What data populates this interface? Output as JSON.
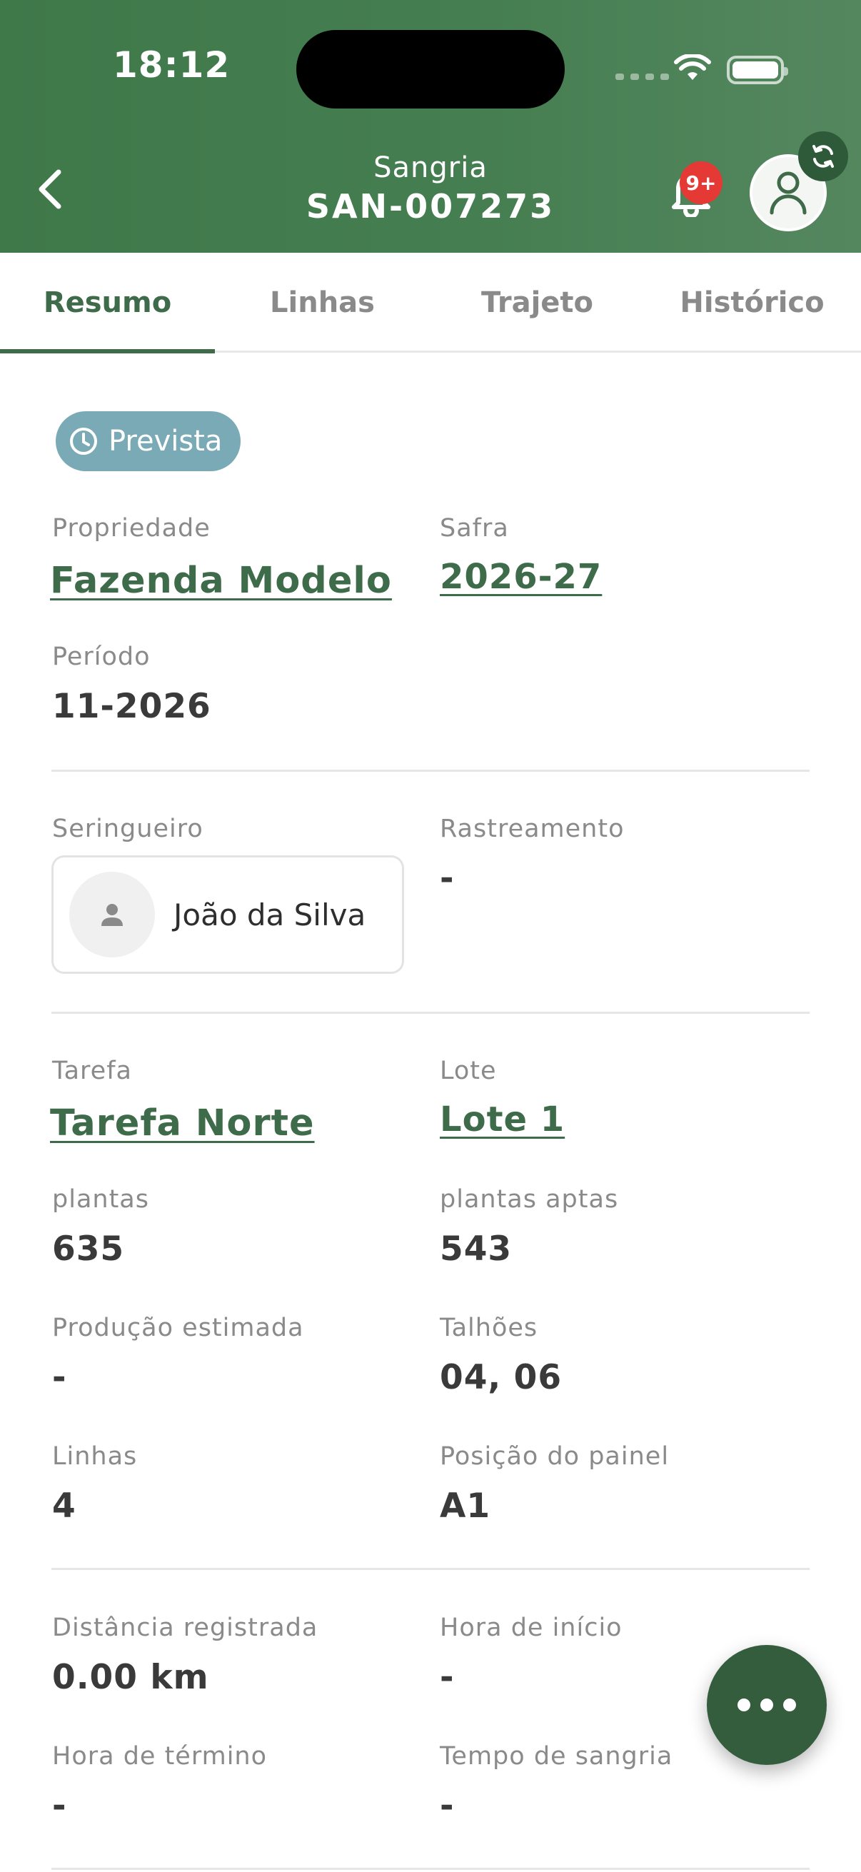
{
  "status_bar": {
    "time": "18:12"
  },
  "header": {
    "subtitle": "Sangria",
    "title": "SAN-007273",
    "notification_badge": "9+",
    "colors": {
      "primary": "#3f7849",
      "badge": "#e53935"
    }
  },
  "tabs": [
    {
      "label": "Resumo",
      "active": true
    },
    {
      "label": "Linhas",
      "active": false
    },
    {
      "label": "Trajeto",
      "active": false
    },
    {
      "label": "Histórico",
      "active": false
    }
  ],
  "status_chip": {
    "label": "Prevista",
    "icon": "clock-icon",
    "color": "#79aab6"
  },
  "summary": {
    "propriedade": {
      "label": "Propriedade",
      "value": "Fazenda Modelo"
    },
    "safra": {
      "label": "Safra",
      "value": "2026-27"
    },
    "periodo": {
      "label": "Período",
      "value": "11-2026"
    }
  },
  "assignment": {
    "seringueiro": {
      "label": "Seringueiro",
      "value": "João da Silva"
    },
    "rastreamento": {
      "label": "Rastreamento",
      "value": "-"
    }
  },
  "task": {
    "tarefa": {
      "label": "Tarefa",
      "value": "Tarefa Norte"
    },
    "lote": {
      "label": "Lote",
      "value": "Lote 1"
    },
    "plantas": {
      "label": "plantas",
      "value": "635"
    },
    "plantas_aptas": {
      "label": "plantas aptas",
      "value": "543"
    },
    "producao_estimada": {
      "label": "Produção estimada",
      "value": "-"
    },
    "talhoes": {
      "label": "Talhões",
      "value": "04, 06"
    },
    "linhas": {
      "label": "Linhas",
      "value": "4"
    },
    "posicao_painel": {
      "label": "Posição do painel",
      "value": "A1"
    }
  },
  "tracking": {
    "distancia": {
      "label": "Distância registrada",
      "value": "0.00 km"
    },
    "hora_inicio": {
      "label": "Hora de início",
      "value": "-"
    },
    "hora_termino": {
      "label": "Hora de término",
      "value": "-"
    },
    "tempo_sangria": {
      "label": "Tempo de sangria",
      "value": "-"
    }
  },
  "fab": {
    "icon": "more-horizontal-icon"
  }
}
